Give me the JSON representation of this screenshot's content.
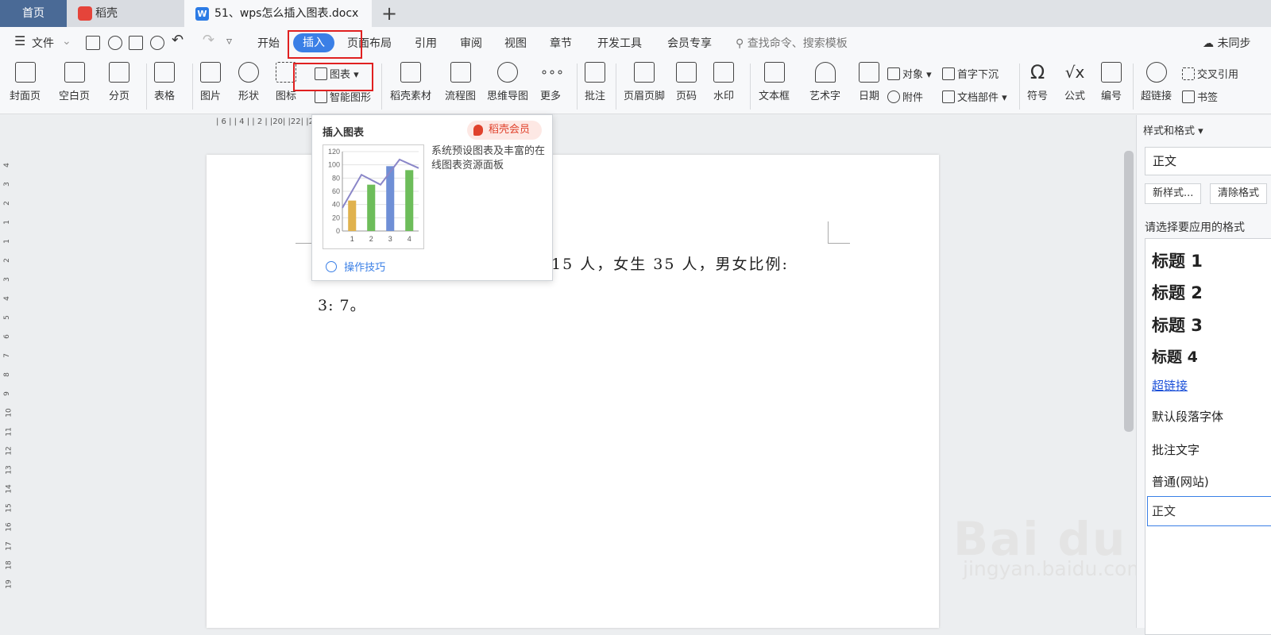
{
  "tabs": {
    "home": "首页",
    "daoke": "稻壳",
    "doc": "51、wps怎么插入图表.docx",
    "new_tab": "+"
  },
  "menubar": {
    "file": "文件",
    "items": [
      "开始",
      "插入",
      "页面布局",
      "引用",
      "审阅",
      "视图",
      "章节",
      "开发工具",
      "会员专享"
    ],
    "search": "查找命令、搜索模板",
    "sync": "未同步"
  },
  "toolbar": {
    "cover": "封面页",
    "blank": "空白页",
    "pagebreak": "分页",
    "table": "表格",
    "picture": "图片",
    "shape": "形状",
    "icon": "图标",
    "chart": "图表",
    "smart_graphic": "智能图形",
    "daoke_material": "稻壳素材",
    "flowchart": "流程图",
    "mindmap": "思维导图",
    "more": "更多",
    "comment": "批注",
    "header_footer": "页眉页脚",
    "page_number": "页码",
    "watermark": "水印",
    "textbox": "文本框",
    "wordart": "艺术字",
    "date": "日期",
    "object": "对象",
    "attachment": "附件",
    "dropcap": "首字下沉",
    "doc_parts": "文档部件",
    "symbol": "符号",
    "formula": "公式",
    "numbering": "编号",
    "hyperlink": "超链接",
    "crossref": "交叉引用",
    "bookmark": "书签"
  },
  "ruler": {
    "numbers": "| 6 |  | 4 |  | 2 |   |20|  |22|  |24|  |26|  |28|  |30|  |32|  |34|  |36|  |38|  |40|  |42|  |44|  |46|  |",
    "vertical": [
      "4",
      "3",
      "2",
      "1",
      "1",
      "2",
      "3",
      "4",
      "5",
      "6",
      "7",
      "8",
      "9",
      "10",
      "11",
      "12",
      "13",
      "14",
      "15",
      "16",
      "17",
      "18",
      "19"
    ]
  },
  "document": {
    "line1": "15 人，女生 35 人，男女比例:",
    "line2": "3: 7。"
  },
  "popup": {
    "title": "插入图表",
    "member": "稻壳会员",
    "desc": "系统预设图表及丰富的在线图表资源面板",
    "tips": "操作技巧"
  },
  "chart_data": {
    "type": "bar",
    "categories": [
      "1",
      "2",
      "3",
      "4"
    ],
    "values": [
      46,
      70,
      98,
      92
    ],
    "line_values": [
      35,
      85,
      70,
      108,
      95
    ],
    "bar_colors": [
      "#e0b24d",
      "#6dbd5a",
      "#6f8fd6",
      "#6dbd5a"
    ],
    "line_color": "#8a86c8",
    "yticks": [
      "120",
      "100",
      "80",
      "60",
      "40",
      "20",
      "0"
    ],
    "ylim": [
      0,
      120
    ],
    "title": "",
    "xlabel": "",
    "ylabel": ""
  },
  "rpanel": {
    "title": "样式和格式",
    "current_style": "正文",
    "new_style": "新样式...",
    "clear": "清除格式",
    "hint": "请选择要应用的格式",
    "items": [
      "标题  1",
      "标题  2",
      "标题  3",
      "标题  4",
      "超链接",
      "默认段落字体",
      "批注文字",
      "普通(网站)",
      "正文"
    ]
  },
  "watermark": {
    "brand": "Bai du 经验",
    "url": "jingyan.baidu.com"
  },
  "colors": {
    "accent": "#3a7fe6",
    "highlight": "#e02020",
    "home_tab": "#4a6a96"
  }
}
